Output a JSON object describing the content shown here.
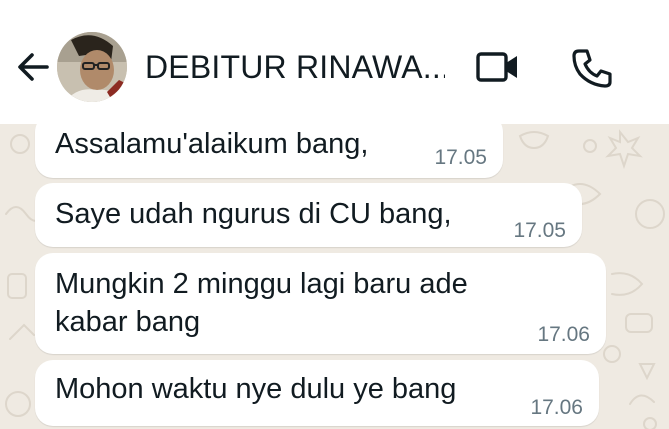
{
  "header": {
    "contact_name": "DEBITUR RINAWA...",
    "back_icon": "arrow-left-icon",
    "video_icon": "video-camera-icon",
    "call_icon": "phone-icon"
  },
  "messages": [
    {
      "text": "Assalamu'alaikum bang,",
      "time": "17.05"
    },
    {
      "text": "Saye udah ngurus di CU bang,",
      "time": "17.05"
    },
    {
      "text": "Mungkin 2 minggu lagi baru ade\nkabar bang",
      "time": "17.06"
    },
    {
      "text": "Mohon waktu nye dulu ye bang",
      "time": "17.06"
    }
  ],
  "colors": {
    "header_bg": "#ffffff",
    "chat_bg": "#efeae2",
    "bubble_bg": "#ffffff",
    "text": "#111b21",
    "timestamp": "#667781"
  }
}
